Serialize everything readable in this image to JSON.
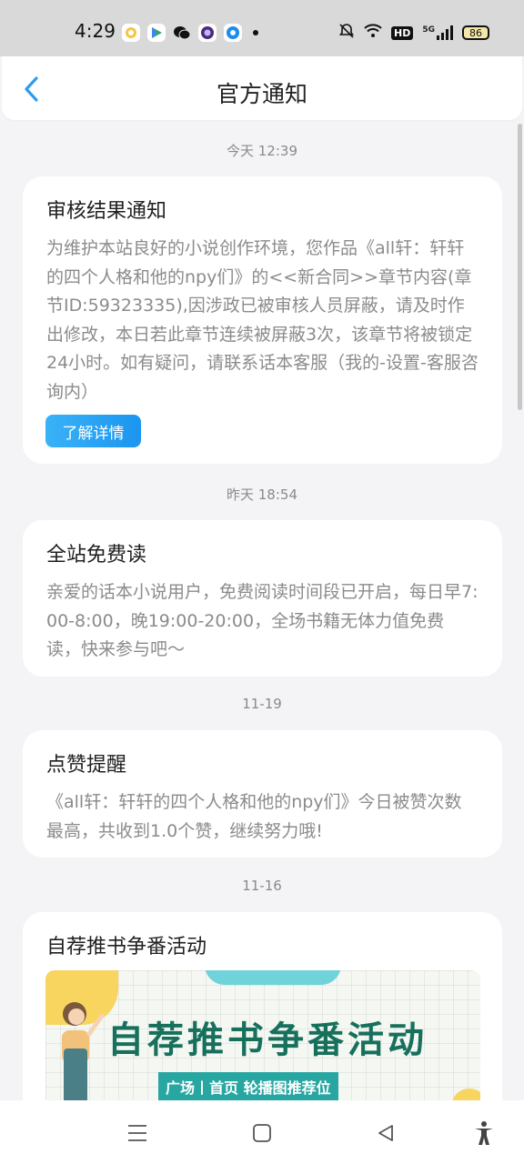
{
  "status_bar": {
    "time": "4:29",
    "network": "5G",
    "hd": "HD",
    "battery": "86",
    "icons": [
      "app-badge-icon",
      "play-store-icon",
      "wechat-icon",
      "purple-app-icon",
      "blue-app-icon",
      "notification-dot-icon",
      "mute-bell-icon",
      "wifi-icon",
      "hd-icon",
      "signal-icon",
      "battery-icon"
    ]
  },
  "header": {
    "title": "官方通知",
    "back_icon": "chevron-left-icon",
    "accent": "#2e9cf0"
  },
  "feed": [
    {
      "timestamp": "今天 12:39",
      "title": "审核结果通知",
      "body": "为维护本站良好的小说创作环境，您作品《all轩：轩轩的四个人格和他的npy们》的<<新合同>>章节内容(章节ID:59323335),因涉政已被审核人员屏蔽，请及时作出修改，本日若此章节连续被屏蔽3次，该章节将被锁定24小时。如有疑问，请联系话本客服（我的-设置-客服咨询内）",
      "button": "了解详情"
    },
    {
      "timestamp": "昨天 18:54",
      "title": "全站免费读",
      "body": "亲爱的话本小说用户，免费阅读时间段已开启，每日早7:00-8:00，晚19:00-20:00，全场书籍无体力值免费读，快来参与吧～"
    },
    {
      "timestamp": "11-19",
      "title": "点赞提醒",
      "body": "《all轩：轩轩的四个人格和他的npy们》今日被赞次数最高，共收到1.0个赞，继续努力哦!"
    },
    {
      "timestamp": "11-16",
      "title": "自荐推书争番活动",
      "banner_title": "自荐推书争番活动",
      "banner_subtitle": "广场丨首页 轮播图推荐位"
    }
  ],
  "nav_bar": {
    "icons": [
      "menu-icon",
      "home-icon",
      "back-triangle-icon",
      "accessibility-icon"
    ]
  },
  "colors": {
    "button_gradient_start": "#3ab2f8",
    "button_gradient_end": "#1b95ef",
    "banner_green": "#17705c",
    "banner_teal": "#27a6a2",
    "banner_yellow": "#f7d55e"
  }
}
